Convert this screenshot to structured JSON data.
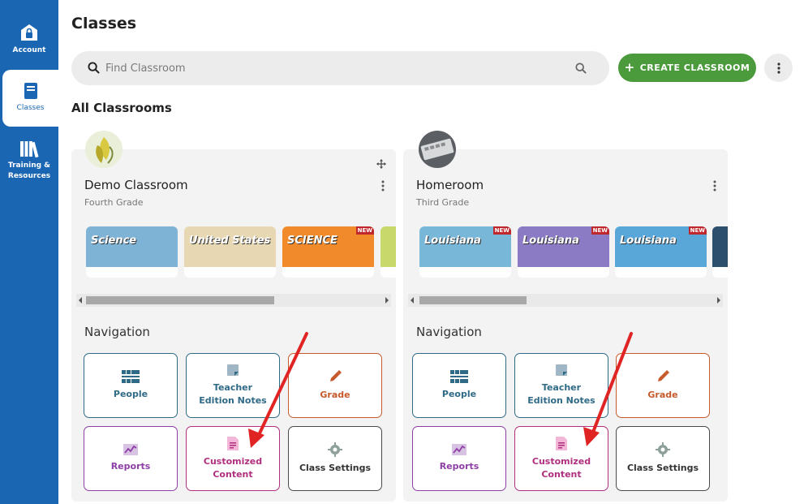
{
  "sidebar": {
    "items": [
      {
        "label": "Account",
        "icon": "house-lock-icon"
      },
      {
        "label": "Classes",
        "icon": "book-icon"
      },
      {
        "label": "Training & Resources",
        "icon": "library-books-icon"
      }
    ]
  },
  "header": {
    "title": "Classes",
    "search_placeholder": "Find Classroom",
    "create_label": "CREATE CLASSROOM",
    "create_icon": "plus-icon"
  },
  "section_title": "All Classrooms",
  "classrooms": [
    {
      "name": "Demo Classroom",
      "grade": "Fourth Grade",
      "books": [
        {
          "title": "Science",
          "color": "#7fb3d6"
        },
        {
          "title": "United States",
          "color": "#e7d8b3"
        },
        {
          "title": "SCIENCE",
          "color": "#f08a2b",
          "badge": "NEW"
        },
        {
          "title": "",
          "color": "#c9d86a"
        }
      ],
      "navigation_title": "Navigation",
      "tiles": [
        {
          "label": "People",
          "icon": "people-icon",
          "style": "teal"
        },
        {
          "label": "Teacher Edition Notes",
          "icon": "notes-icon",
          "style": "teal"
        },
        {
          "label": "Grade",
          "icon": "pencil-icon",
          "style": "orange"
        },
        {
          "label": "Reports",
          "icon": "chart-icon",
          "style": "purple"
        },
        {
          "label": "Customized Content",
          "icon": "document-icon",
          "style": "pink"
        },
        {
          "label": "Class Settings",
          "icon": "gear-icon",
          "style": "gray"
        }
      ]
    },
    {
      "name": "Homeroom",
      "grade": "Third Grade",
      "books": [
        {
          "title": "Louisiana",
          "color": "#79b7d8",
          "badge": "NEW"
        },
        {
          "title": "Louisiana",
          "color": "#8a7bc4",
          "badge": "NEW"
        },
        {
          "title": "Louisiana",
          "color": "#59a6d9",
          "badge": "NEW"
        },
        {
          "title": "",
          "color": "#2d4f6e"
        }
      ],
      "navigation_title": "Navigation",
      "tiles": [
        {
          "label": "People",
          "icon": "people-icon",
          "style": "teal"
        },
        {
          "label": "Teacher Edition Notes",
          "icon": "notes-icon",
          "style": "teal"
        },
        {
          "label": "Grade",
          "icon": "pencil-icon",
          "style": "orange"
        },
        {
          "label": "Reports",
          "icon": "chart-icon",
          "style": "purple"
        },
        {
          "label": "Customized Content",
          "icon": "document-icon",
          "style": "pink"
        },
        {
          "label": "Class Settings",
          "icon": "gear-icon",
          "style": "gray"
        }
      ]
    }
  ],
  "colors": {
    "sidebar": "#1a66b3",
    "create_button": "#4b9b3d",
    "annotation_arrow": "#e02424"
  }
}
